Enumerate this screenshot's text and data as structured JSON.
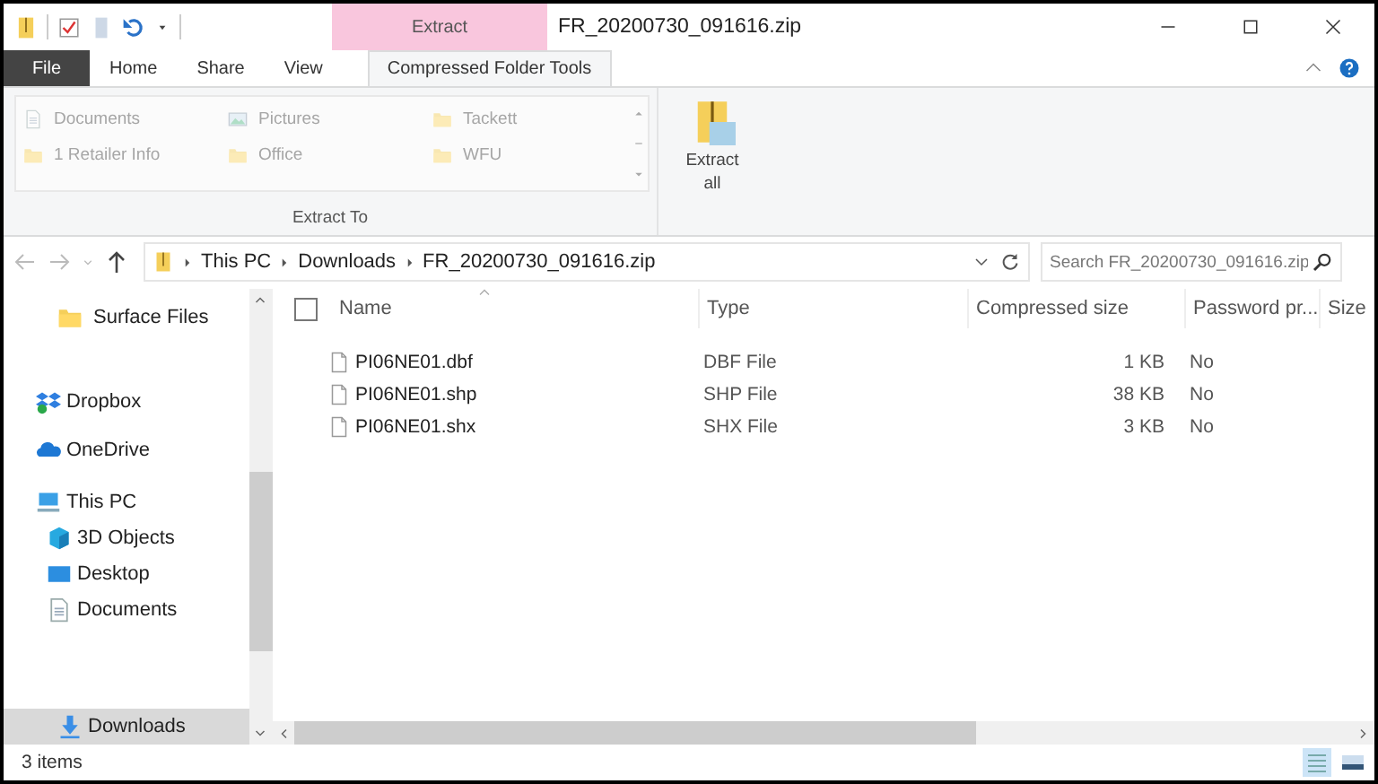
{
  "window": {
    "title": "FR_20200730_091616.zip",
    "context_tab": "Extract"
  },
  "tabs": [
    {
      "label": "File",
      "kind": "file",
      "selected": false
    },
    {
      "label": "Home",
      "kind": "tab",
      "selected": false
    },
    {
      "label": "Share",
      "kind": "tab",
      "selected": false
    },
    {
      "label": "View",
      "kind": "tab",
      "selected": false
    },
    {
      "label": "Compressed Folder Tools",
      "kind": "tab",
      "selected": true
    }
  ],
  "ribbon": {
    "destinations": [
      {
        "label": "Documents",
        "kind": "document"
      },
      {
        "label": "Pictures",
        "kind": "picture"
      },
      {
        "label": "Tackett",
        "kind": "folder"
      },
      {
        "label": "1 Retailer Info",
        "kind": "folder"
      },
      {
        "label": "Office",
        "kind": "folder"
      },
      {
        "label": "WFU",
        "kind": "folder"
      }
    ],
    "group_label": "Extract To",
    "extract_all": "Extract all"
  },
  "address": {
    "crumbs": [
      "This PC",
      "Downloads",
      "FR_20200730_091616.zip"
    ],
    "search_placeholder": "Search FR_20200730_091616.zip"
  },
  "nav": [
    {
      "items": [
        {
          "label": "Surface Files",
          "kind": "folder",
          "selected": false
        }
      ]
    },
    {
      "items": [
        {
          "label": "Dropbox",
          "kind": "dropbox",
          "selected": false
        }
      ]
    },
    {
      "items": [
        {
          "label": "OneDrive",
          "kind": "onedrive",
          "selected": false
        }
      ]
    },
    {
      "items": [
        {
          "label": "This PC",
          "kind": "pc",
          "selected": false,
          "children": [
            {
              "label": "3D Objects",
              "kind": "cube",
              "selected": false
            },
            {
              "label": "Desktop",
              "kind": "desktop",
              "selected": false
            },
            {
              "label": "Documents",
              "kind": "document",
              "selected": false
            }
          ]
        }
      ]
    },
    {
      "items": [
        {
          "label": "Downloads",
          "kind": "download",
          "selected": true
        }
      ]
    }
  ],
  "table": {
    "select_all": {
      "checked": false
    },
    "columns": [
      "Name",
      "Type",
      "Compressed size",
      "Password pr...",
      "Size"
    ],
    "rows": [
      [
        "PI06NE01.dbf",
        "DBF File",
        "1 KB",
        "No"
      ],
      [
        "PI06NE01.shp",
        "SHP File",
        "38 KB",
        "No"
      ],
      [
        "PI06NE01.shx",
        "SHX File",
        "3 KB",
        "No"
      ]
    ]
  },
  "status_bar": {
    "text": "3 items"
  }
}
